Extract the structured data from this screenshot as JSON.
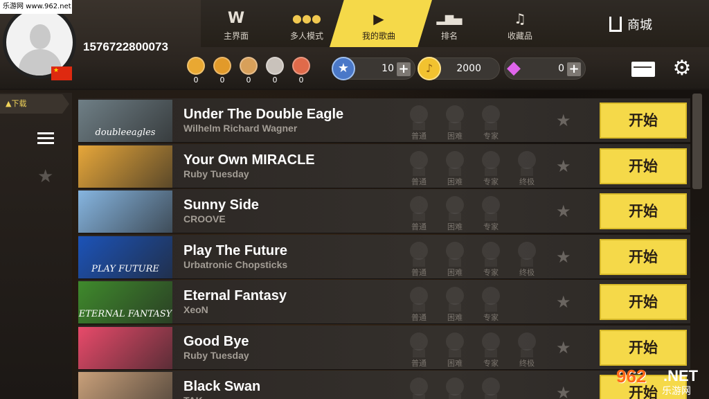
{
  "watermark": {
    "top": "乐游网 www.962.net",
    "bottom_num": "962",
    "bottom_tld": ".NET",
    "bottom_sub": "乐游网"
  },
  "profile": {
    "username": "1576722800073",
    "flag": "★"
  },
  "nav": {
    "items": [
      {
        "label": "主界面",
        "icon": "main-logo-icon",
        "glyph": "W"
      },
      {
        "label": "多人模式",
        "icon": "multiplayer-icon",
        "glyph": "♟♟♟"
      },
      {
        "label": "我的歌曲",
        "icon": "play-icon",
        "glyph": "▶"
      },
      {
        "label": "排名",
        "icon": "ranking-icon",
        "glyph": "▮"
      },
      {
        "label": "收藏品",
        "icon": "collection-icon",
        "glyph": "♫"
      }
    ],
    "active_index": 2,
    "shop_label": "商城"
  },
  "medals": [
    {
      "name": "gold-medal",
      "count": "0",
      "color": "#e9a832"
    },
    {
      "name": "gold-medal-2",
      "count": "0",
      "color": "#e29a2a"
    },
    {
      "name": "bronze-medal",
      "count": "0",
      "color": "#d8a05a"
    },
    {
      "name": "silver-medal",
      "count": "0",
      "color": "#c9c2bb"
    },
    {
      "name": "red-medal",
      "count": "0",
      "color": "#e06a4a"
    }
  ],
  "currency": {
    "stars": {
      "value": "10",
      "icon": "star-coin-icon",
      "color": "#4a78c8"
    },
    "gold": {
      "value": "2000",
      "icon": "gold-coin-icon",
      "color": "#f2c230"
    },
    "diamond": {
      "value": "0",
      "icon": "diamond-icon",
      "color": "#d05ad8"
    }
  },
  "left": {
    "download_label": "▲下载"
  },
  "difficulty_labels": {
    "normal": "普通",
    "hard": "困难",
    "expert": "专家",
    "ultimate": "终极"
  },
  "start_label": "开始",
  "songs": [
    {
      "title": "Under The Double Eagle",
      "artist": "Wilhelm Richard Wagner",
      "thumb_text": "doubleeagles",
      "thumb_bg": "#6f7f86",
      "ultimate": false
    },
    {
      "title": "Your Own MIRACLE",
      "artist": "Ruby Tuesday",
      "thumb_text": "",
      "thumb_bg": "#e7a73a",
      "ultimate": true
    },
    {
      "title": "Sunny Side",
      "artist": "CROOVE",
      "thumb_text": "",
      "thumb_bg": "#86b5e0",
      "ultimate": false
    },
    {
      "title": "Play The Future",
      "artist": "Urbatronic Chopsticks",
      "thumb_text": "PLAY FUTURE",
      "thumb_bg": "#1c53b8",
      "ultimate": true
    },
    {
      "title": "Eternal Fantasy",
      "artist": "XeoN",
      "thumb_text": "ETERNAL FANTASY",
      "thumb_bg": "#3f8a2c",
      "ultimate": false
    },
    {
      "title": "Good Bye",
      "artist": "Ruby Tuesday",
      "thumb_text": "",
      "thumb_bg": "#e84a6a",
      "ultimate": true
    },
    {
      "title": "Black Swan",
      "artist": "TAK",
      "thumb_text": "",
      "thumb_bg": "#c9a07a",
      "ultimate": false
    }
  ]
}
